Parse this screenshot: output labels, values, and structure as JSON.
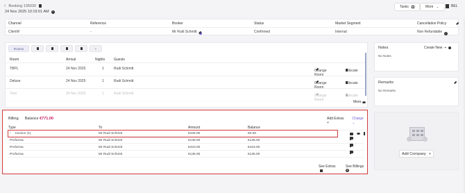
{
  "header": {
    "back_label": "Booking 135030",
    "created": "24 Nov 2025 10:19:01 AM",
    "tasks_label": "Tasks",
    "more_label": "More",
    "lang_label": "BEL"
  },
  "summary": {
    "columns": [
      "Channel",
      "Reference",
      "Booker",
      "Status",
      "Market Segment",
      "Cancellation Policy"
    ],
    "values": {
      "channel": "ClienW",
      "reference": "-",
      "booker": "Mr Rudi Schmitt",
      "status": "Confirmed",
      "market_segment": "Internal",
      "cancellation_policy": "Non Refundable"
    }
  },
  "rooms": {
    "tabs": [
      {
        "label": "Rooms",
        "active": true
      },
      {
        "label": "",
        "icon": "bed-icon"
      },
      {
        "label": "",
        "icon": "doc-icon"
      },
      {
        "label": "",
        "icon": "card-icon"
      },
      {
        "label": "",
        "icon": "bin-icon"
      },
      {
        "label": "+",
        "icon": "plus-icon"
      }
    ],
    "columns": [
      "Room",
      "Arrival",
      "Nights",
      "Guests"
    ],
    "rows": [
      {
        "room": "TBPL",
        "arrival": "24 Nov 2025",
        "nights": "1",
        "guest": "Rudi Schmitt"
      },
      {
        "room": "Deluxe",
        "arrival": "24 Nov 2025",
        "nights": "1",
        "guest": "Rudi Schmitt"
      },
      {
        "room": "Twin",
        "arrival": "24 Nov 2025",
        "nights": "1",
        "guest": "Rudi Schmitt"
      }
    ],
    "change_room_label": "Change Room",
    "allocate_label": "Allocate",
    "more_label": "More"
  },
  "billing": {
    "title": "Billing",
    "balance_label": "Balance",
    "balance_value": "€771.00",
    "add_extras_label": "Add Extras",
    "charge_label": "Charge",
    "columns": [
      "Type",
      "To",
      "Amount",
      "Balance"
    ],
    "rows": [
      {
        "type": "Invoice (1)",
        "to": "Mr Rudi Schmitt",
        "amount": "€426.00",
        "balance": "€0.00"
      },
      {
        "type": "Proforma",
        "to": "Mr Rudi Schmitt",
        "amount": "€136.00",
        "balance": "€136.00"
      },
      {
        "type": "Proforma",
        "to": "Mr Rudi Schmitt",
        "amount": "€423.00",
        "balance": "€423.00"
      },
      {
        "type": "Proforma",
        "to": "Mr Rudi Schmitt",
        "amount": "€136.00",
        "balance": "€136.00"
      }
    ],
    "see_extras_label": "See Extras",
    "see_billings_label": "See Billings"
  },
  "notes": {
    "title": "Notes",
    "create_new_label": "Create New",
    "empty": "No Notes"
  },
  "remarks": {
    "title": "Remarks",
    "empty": "No Remarks"
  },
  "company": {
    "add_label": "Add Company"
  },
  "colors": {
    "accent": "#6b5bd3",
    "highlight_red": "#d33a3a",
    "balance": "#c2185b"
  }
}
